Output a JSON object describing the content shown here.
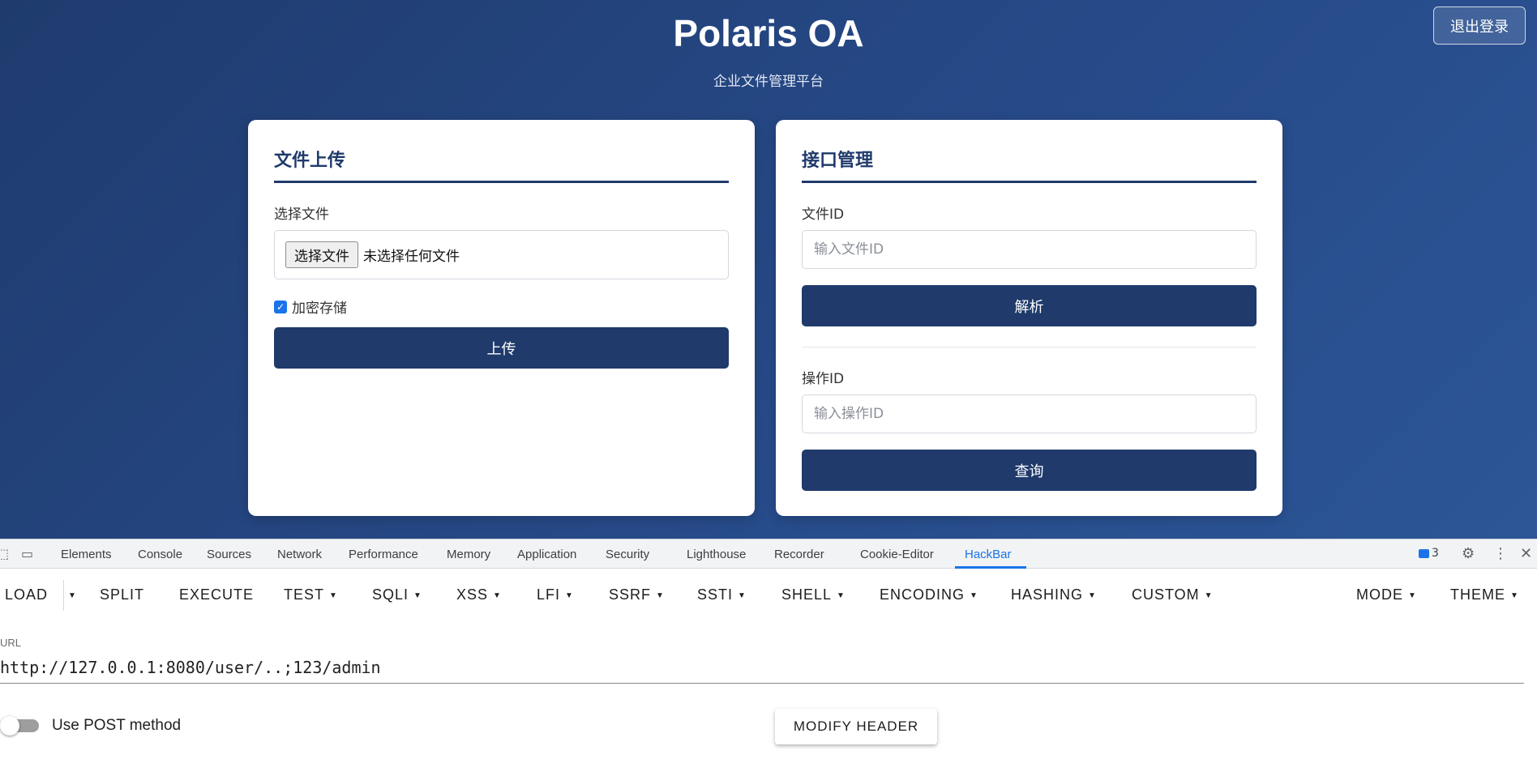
{
  "app": {
    "title": "Polaris OA",
    "subtitle": "企业文件管理平台",
    "logout_label": "退出登录"
  },
  "upload_card": {
    "title": "文件上传",
    "file_label": "选择文件",
    "file_button": "选择文件",
    "file_status": "未选择任何文件",
    "encrypt_label": "加密存储",
    "encrypt_checked": true,
    "upload_button": "上传"
  },
  "api_card": {
    "title": "接口管理",
    "file_id_label": "文件ID",
    "file_id_placeholder": "输入文件ID",
    "parse_button": "解析",
    "op_id_label": "操作ID",
    "op_id_placeholder": "输入操作ID",
    "query_button": "查询"
  },
  "devtools": {
    "tabs": [
      "Elements",
      "Console",
      "Sources",
      "Network",
      "Performance",
      "Memory",
      "Application",
      "Security",
      "Lighthouse",
      "Recorder",
      "Cookie-Editor",
      "HackBar"
    ],
    "active_tab": "HackBar",
    "issues_count": "3"
  },
  "hackbar": {
    "buttons": {
      "load": "LOAD",
      "split": "SPLIT",
      "execute": "EXECUTE",
      "test": "TEST",
      "sqli": "SQLI",
      "xss": "XSS",
      "lfi": "LFI",
      "ssrf": "SSRF",
      "ssti": "SSTI",
      "shell": "SHELL",
      "encoding": "ENCODING",
      "hashing": "HASHING",
      "custom": "CUSTOM",
      "mode": "MODE",
      "theme": "THEME"
    },
    "url_label": "URL",
    "url_value": "http://127.0.0.1:8080/user/..;123/admin",
    "post_toggle_label": "Use POST method",
    "post_enabled": false,
    "modify_header_label": "MODIFY HEADER"
  }
}
